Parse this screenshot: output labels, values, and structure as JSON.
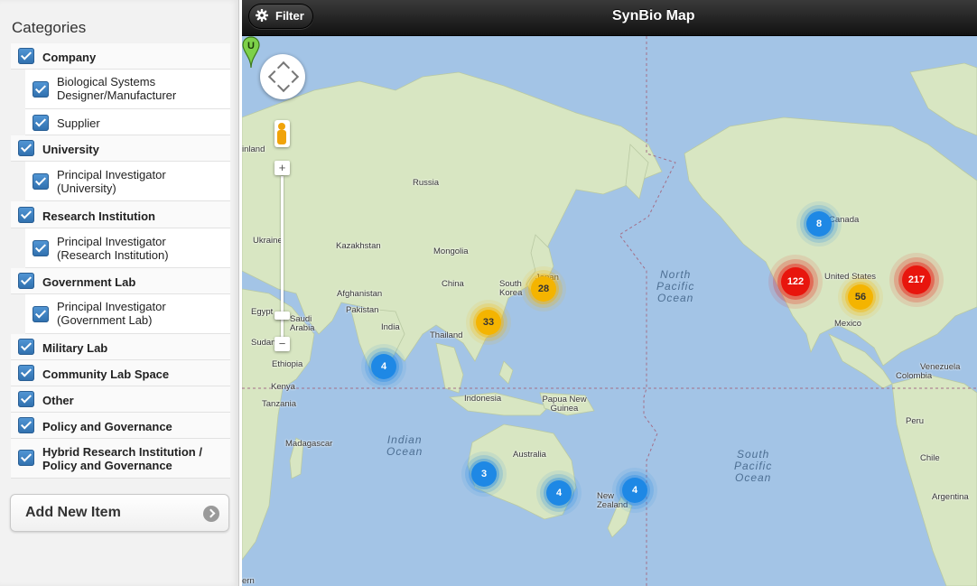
{
  "sidebar": {
    "heading": "Categories",
    "categories": [
      {
        "label": "Company",
        "checked": true,
        "level": "main"
      },
      {
        "label": "Biological Systems Designer/Manufacturer",
        "checked": true,
        "level": "sub"
      },
      {
        "label": "Supplier",
        "checked": true,
        "level": "sub"
      },
      {
        "label": "University",
        "checked": true,
        "level": "main"
      },
      {
        "label": "Principal Investigator (University)",
        "checked": true,
        "level": "sub"
      },
      {
        "label": "Research Institution",
        "checked": true,
        "level": "main"
      },
      {
        "label": "Principal Investigator (Research Institution)",
        "checked": true,
        "level": "sub"
      },
      {
        "label": "Government Lab",
        "checked": true,
        "level": "main"
      },
      {
        "label": "Principal Investigator (Government Lab)",
        "checked": true,
        "level": "sub"
      },
      {
        "label": "Military Lab",
        "checked": true,
        "level": "main"
      },
      {
        "label": "Community Lab Space",
        "checked": true,
        "level": "main"
      },
      {
        "label": "Other",
        "checked": true,
        "level": "main"
      },
      {
        "label": "Policy and Governance",
        "checked": true,
        "level": "main"
      },
      {
        "label": "Hybrid Research Institution / Policy and Governance",
        "checked": true,
        "level": "main"
      }
    ],
    "add_button": "Add New Item"
  },
  "header": {
    "filter_label": "Filter",
    "title": "SynBio Map"
  },
  "map": {
    "places": {
      "russia": "Russia",
      "finland": "inland",
      "ukraine": "Ukraine",
      "kazakhstan": "Kazakhstan",
      "mongolia": "Mongolia",
      "china": "China",
      "south_korea": "South Korea",
      "japan": "Japan",
      "afghanistan": "Afghanistan",
      "pakistan": "Pakistan",
      "egypt": "Egypt",
      "saudi_arabia": "Saudi Arabia",
      "india": "India",
      "thailand": "Thailand",
      "sudan": "Sudan",
      "ethiopia": "Ethiopia",
      "kenya": "Kenya",
      "tanzania": "Tanzania",
      "madagascar": "Madagascar",
      "indonesia": "Indonesia",
      "papua_new_guinea": "Papua New Guinea",
      "australia": "Australia",
      "new_zealand": "New Zealand",
      "canada": "Canada",
      "united_states": "United States",
      "mexico": "Mexico",
      "venezuela": "Venezuela",
      "colombia": "Colombia",
      "peru": "Peru",
      "chile": "Chile",
      "argentina": "Argentina",
      "southern": "ern"
    },
    "oceans": {
      "north_pacific": "North\nPacific\nOcean",
      "indian": "Indian\nOcean",
      "south_pacific": "South\nPacific\nOcean"
    },
    "clusters": [
      {
        "id": "c-south-asia",
        "count": "4",
        "color": "blue"
      },
      {
        "id": "c-japan",
        "count": "28",
        "color": "yellow"
      },
      {
        "id": "c-china-se",
        "count": "33",
        "color": "yellow"
      },
      {
        "id": "c-australia-w",
        "count": "3",
        "color": "blue"
      },
      {
        "id": "c-australia-se",
        "count": "4",
        "color": "blue"
      },
      {
        "id": "c-new-zealand",
        "count": "4",
        "color": "blue"
      },
      {
        "id": "c-canada",
        "count": "8",
        "color": "blue"
      },
      {
        "id": "c-us-west",
        "count": "122",
        "color": "red"
      },
      {
        "id": "c-us-central",
        "count": "56",
        "color": "yellow"
      },
      {
        "id": "c-us-east",
        "count": "217",
        "color": "red"
      }
    ],
    "marker_letter": "U",
    "colors": {
      "water": "#a3c4e6",
      "land": "#d8e6c2",
      "cluster_blue": "#1e88e5",
      "cluster_yellow": "#f4b400",
      "cluster_red": "#e8150d"
    }
  }
}
